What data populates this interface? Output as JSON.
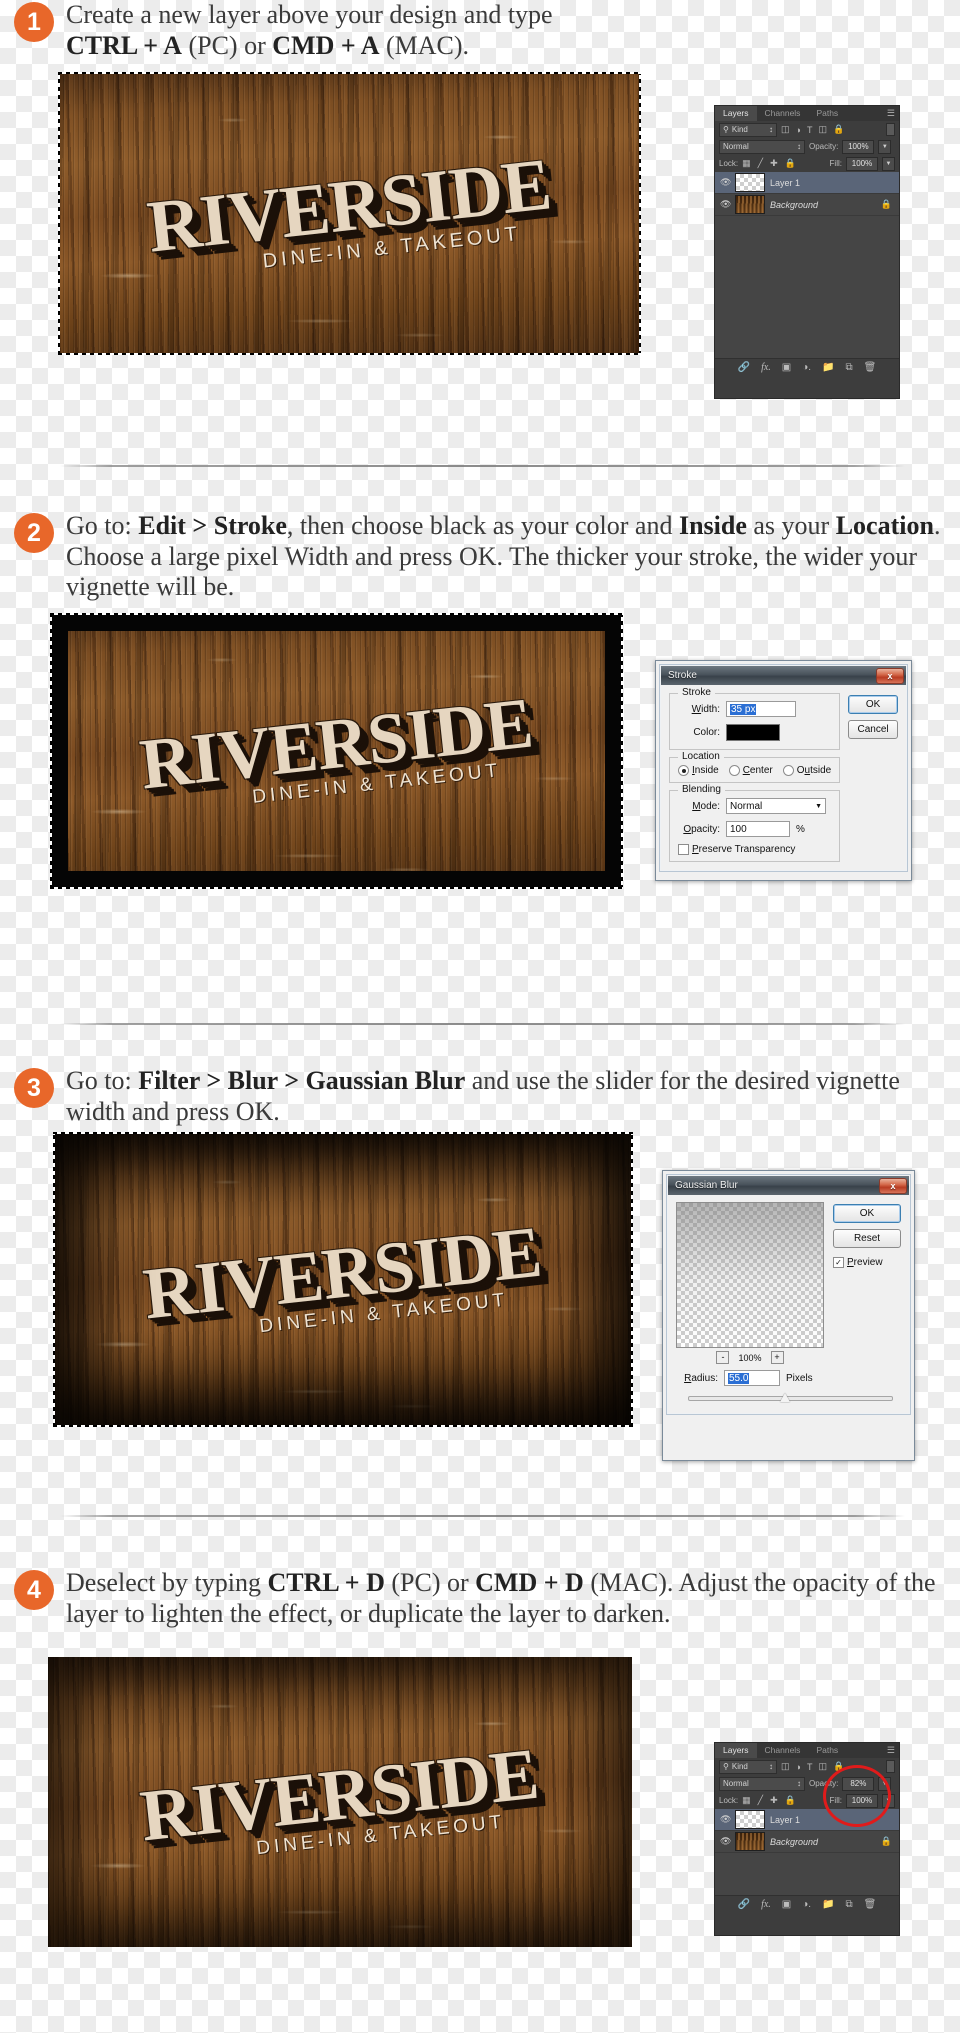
{
  "tutorial": {
    "steps": [
      {
        "number": "1",
        "text_html": "Create a new layer above your design and type<br><b>CTRL + A</b> (PC) or <b>CMD + A</b> (MAC)."
      },
      {
        "number": "2",
        "text_html": "Go to: <b>Edit &gt; Stroke</b>, then choose black as your color and <b>Inside</b> as your <b>Location</b>. Choose a large pixel Width and press OK. The thicker your stroke, the wider your vignette will be."
      },
      {
        "number": "3",
        "text_html": "Go to: <b>Filter &gt; Blur &gt; Gaussian Blur</b> and use the slider for the desired vignette width and press OK."
      },
      {
        "number": "4",
        "text_html": "Deselect by typing <b>CTRL + D</b> (PC) or <b>CMD + D</b> (MAC). Adjust the opacity of the layer to lighten the effect, or duplicate the layer to darken."
      }
    ]
  },
  "artwork": {
    "title": "RIVERSIDE",
    "tagline": "DINE-IN & TAKEOUT"
  },
  "layers_panel_top": {
    "tabs": [
      "Layers",
      "Channels",
      "Paths"
    ],
    "active_tab": "Layers",
    "filter_label": "Kind",
    "filter_icons": [
      "pixel-layer-icon",
      "adjustment-layer-icon",
      "type-layer-icon",
      "shape-layer-icon",
      "smart-object-icon",
      "filter-toggle-icon"
    ],
    "blend_mode": "Normal",
    "opacity_label": "Opacity:",
    "opacity_value": "100%",
    "lock_label": "Lock:",
    "lock_icons": [
      "lock-transparent-pixels-icon",
      "lock-image-pixels-icon",
      "lock-position-icon",
      "lock-all-icon"
    ],
    "fill_label": "Fill:",
    "fill_value": "100%",
    "layers": [
      {
        "name": "Layer 1",
        "thumb": "transparent",
        "selected": true,
        "locked": false,
        "italic": false
      },
      {
        "name": "Background",
        "thumb": "wood",
        "selected": false,
        "locked": true,
        "italic": true
      }
    ],
    "footer_icons": [
      "link-layers-icon",
      "layer-style-fx-icon",
      "layer-mask-icon",
      "adjustment-layer-icon",
      "new-group-icon",
      "new-layer-icon",
      "delete-layer-icon"
    ]
  },
  "layers_panel_bottom": {
    "tabs": [
      "Layers",
      "Channels",
      "Paths"
    ],
    "active_tab": "Layers",
    "filter_label": "Kind",
    "blend_mode": "Normal",
    "opacity_label": "Opacity:",
    "opacity_value": "82%",
    "lock_label": "Lock:",
    "fill_label": "Fill:",
    "fill_value": "100%",
    "highlight_color": "#e01b1b",
    "layers": [
      {
        "name": "Layer 1",
        "thumb": "transparent",
        "selected": true,
        "locked": false,
        "italic": false
      },
      {
        "name": "Background",
        "thumb": "wood",
        "selected": false,
        "locked": true,
        "italic": true
      }
    ],
    "footer_icons": [
      "link-layers-icon",
      "layer-style-fx-icon",
      "layer-mask-icon",
      "adjustment-layer-icon",
      "new-group-icon",
      "new-layer-icon",
      "delete-layer-icon"
    ]
  },
  "stroke_dialog": {
    "title": "Stroke",
    "close_label": "x",
    "group_stroke": "Stroke",
    "width_label": "Width:",
    "width_value": "35 px",
    "color_label": "Color:",
    "color_value": "#000000",
    "group_location": "Location",
    "location_options": [
      "Inside",
      "Center",
      "Outside"
    ],
    "location_selected": "Inside",
    "group_blending": "Blending",
    "mode_label": "Mode:",
    "mode_value": "Normal",
    "opacity_label": "Opacity:",
    "opacity_value": "100",
    "opacity_unit": "%",
    "preserve_label": "Preserve Transparency",
    "preserve_checked": false,
    "ok_label": "OK",
    "cancel_label": "Cancel"
  },
  "gaussian_blur_dialog": {
    "title": "Gaussian Blur",
    "close_label": "x",
    "ok_label": "OK",
    "reset_label": "Reset",
    "preview_label": "Preview",
    "preview_checked": true,
    "zoom_out_label": "-",
    "zoom_value": "100%",
    "zoom_in_label": "+",
    "radius_label": "Radius:",
    "radius_value": "55.0",
    "radius_unit": "Pixels",
    "slider_position_pct": 45
  }
}
